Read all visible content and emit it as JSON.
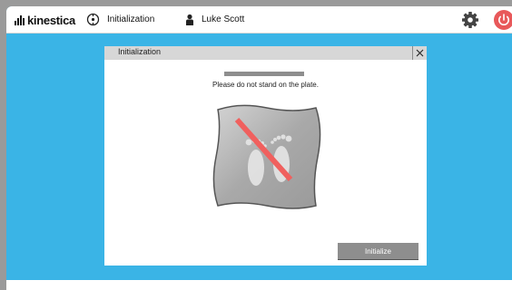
{
  "header": {
    "logo_text": "kinestica",
    "init_label": "Initialization",
    "user_name": "Luke Scott"
  },
  "dialog": {
    "title": "Initialization",
    "close": "X",
    "message": "Please do not stand on the plate.",
    "button_label": "Initialize",
    "progress_fraction": 1.0
  },
  "colors": {
    "background": "#3ab4e6",
    "power": "#e8585a",
    "button": "#8e8e8e",
    "titlebar": "#d7d7d7",
    "prohibit_line": "#f0605e"
  },
  "icons": {
    "init": "initialization-icon",
    "user": "user-icon",
    "settings": "gear-icon",
    "power": "power-icon",
    "plate": "force-plate-no-standing-icon"
  }
}
